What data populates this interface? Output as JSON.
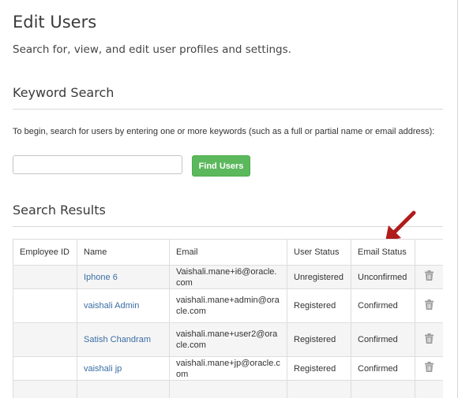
{
  "header": {
    "title": "Edit Users",
    "subtitle": "Search for, view, and edit user profiles and settings."
  },
  "keyword_search": {
    "heading": "Keyword Search",
    "instructions": "To begin, search for users by entering one or more keywords (such as a full or partial name or email address):",
    "input_value": "",
    "input_placeholder": "",
    "button_label": "Find Users"
  },
  "results": {
    "heading": "Search Results",
    "columns": [
      "Employee ID",
      "Name",
      "Email",
      "User Status",
      "Email Status",
      ""
    ],
    "rows": [
      {
        "employee_id": "",
        "name": "Iphone 6",
        "email": "Vaishali.mane+i6@oracle.com",
        "user_status": "Unregistered",
        "email_status": "Unconfirmed",
        "action_icon": "trash-icon"
      },
      {
        "employee_id": "",
        "name": "vaishali Admin",
        "email": "vaishali.mane+admin@oracle.com",
        "user_status": "Registered",
        "email_status": "Confirmed",
        "action_icon": "trash-icon"
      },
      {
        "employee_id": "",
        "name": "Satish Chandram",
        "email": "vaishali.mane+user2@oracle.com",
        "user_status": "Registered",
        "email_status": "Confirmed",
        "action_icon": "trash-icon"
      },
      {
        "employee_id": "",
        "name": "vaishali jp",
        "email": "vaishali.mane+jp@oracle.com",
        "user_status": "Registered",
        "email_status": "Confirmed",
        "action_icon": "trash-icon"
      }
    ]
  },
  "annotation": {
    "icon": "red-arrow-icon",
    "color": "#b01c1c"
  },
  "colors": {
    "accent_button": "#5cb85c",
    "link": "#3a6ea5",
    "row_stripe": "#f5f5f5"
  }
}
